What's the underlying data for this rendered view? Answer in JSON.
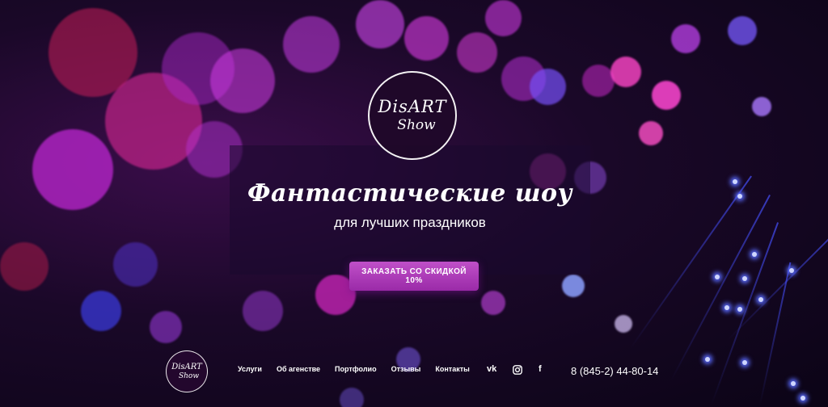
{
  "hero": {
    "logo_line1": "DisART",
    "logo_line2": "Show",
    "title": "Фантастические шоу",
    "subtitle": "для лучших праздников",
    "cta_label": "ЗАКАЗАТЬ СО СКИДКОЙ 10%"
  },
  "footer": {
    "logo_line1": "DisART",
    "logo_line2": "Show",
    "nav": [
      "Услуги",
      "Об агенстве",
      "Портфолио",
      "Отзывы",
      "Контакты"
    ],
    "social": {
      "vk": "vk",
      "instagram_icon": "instagram-icon",
      "facebook": "f"
    },
    "phone": "8 (845-2) 44-80-14"
  },
  "colors": {
    "accent": "#b03fbf",
    "background": "#14061f"
  }
}
